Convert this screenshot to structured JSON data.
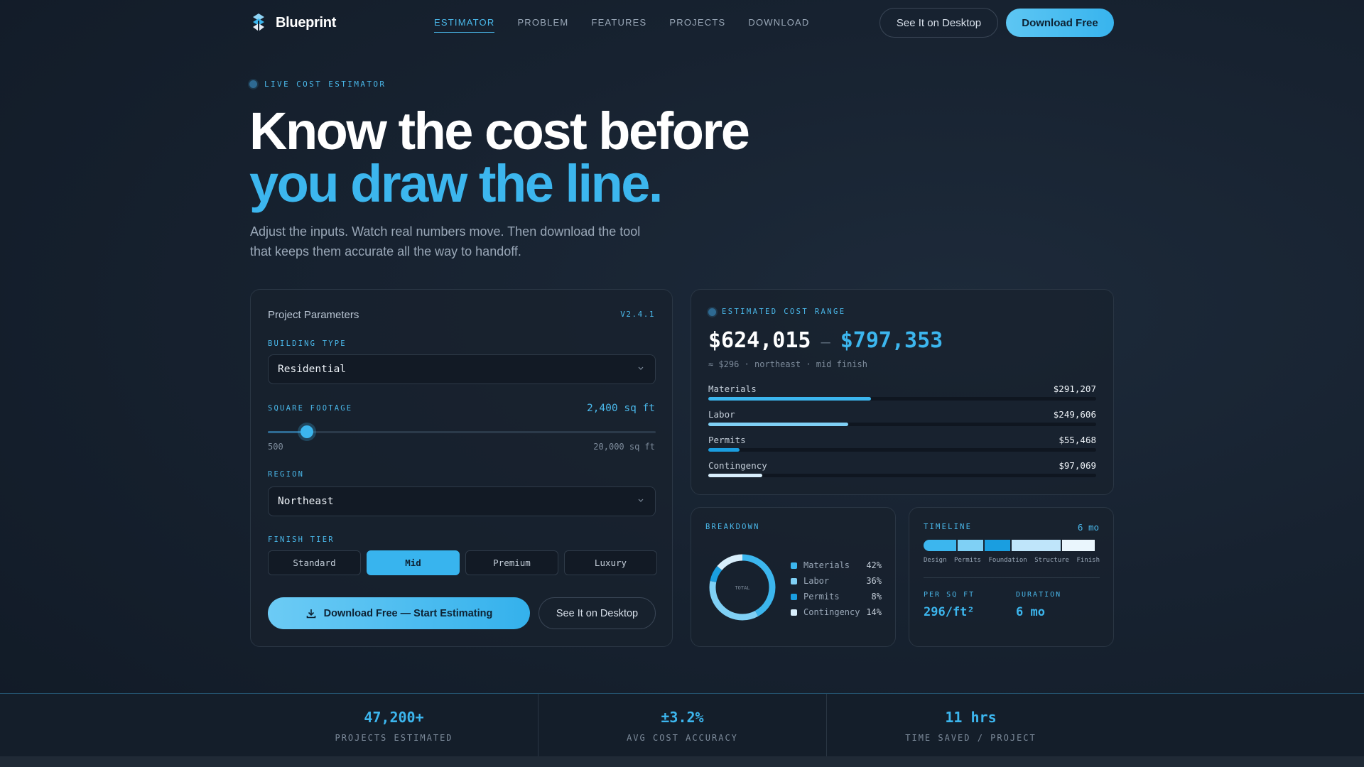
{
  "nav": {
    "brand": "Blueprint",
    "links": [
      "ESTIMATOR",
      "PROBLEM",
      "FEATURES",
      "PROJECTS",
      "DOWNLOAD"
    ],
    "see_desktop": "See It on Desktop",
    "download_free": "Download Free"
  },
  "hero": {
    "eyebrow": "LIVE COST ESTIMATOR",
    "title_line1": "Know the cost before",
    "title_line2": "you draw the line.",
    "subtitle": "Adjust the inputs. Watch real numbers move. Then download the tool that keeps them accurate all the way to handoff."
  },
  "params": {
    "title": "Project Parameters",
    "version": "V2.4.1",
    "building_type_label": "BUILDING TYPE",
    "building_type_value": "Residential",
    "sqft_label": "SQUARE FOOTAGE",
    "sqft_value": "2,400 sq ft",
    "sqft_min": "500",
    "sqft_max": "20,000 sq ft",
    "sqft_slider_fraction": 0.1,
    "region_label": "REGION",
    "region_value": "Northeast",
    "finish_label": "FINISH TIER",
    "tiers": [
      "Standard",
      "Mid",
      "Premium",
      "Luxury"
    ],
    "active_tier": "Mid",
    "cta_primary": "Download Free — Start Estimating",
    "cta_secondary": "See It on Desktop"
  },
  "estimate": {
    "heading": "ESTIMATED COST RANGE",
    "low": "$624,015",
    "dash": "—",
    "high": "$797,353",
    "meta": "≈ $296 · northeast · mid finish",
    "rows": [
      {
        "label": "Materials",
        "value": "$291,207",
        "fraction": 0.42,
        "color": "#3cb6ee"
      },
      {
        "label": "Labor",
        "value": "$249,606",
        "fraction": 0.36,
        "color": "#7fd0f5"
      },
      {
        "label": "Permits",
        "value": "$55,468",
        "fraction": 0.08,
        "color": "#1a9ee0"
      },
      {
        "label": "Contingency",
        "value": "$97,069",
        "fraction": 0.14,
        "color": "#d8eefb"
      }
    ]
  },
  "breakdown": {
    "heading": "BREAKDOWN",
    "center_label": "TOTAL",
    "items": [
      {
        "name": "Materials",
        "pct": "42%",
        "value": 42,
        "color": "#3cb6ee"
      },
      {
        "name": "Labor",
        "pct": "36%",
        "value": 36,
        "color": "#7fd0f5"
      },
      {
        "name": "Permits",
        "pct": "8%",
        "value": 8,
        "color": "#1a9ee0"
      },
      {
        "name": "Contingency",
        "pct": "14%",
        "value": 14,
        "color": "#d8eefb"
      }
    ]
  },
  "timeline": {
    "heading": "TIMELINE",
    "total": "6 mo",
    "phases": [
      {
        "name": "Design",
        "share": 0.19,
        "color": "#3cb6ee"
      },
      {
        "name": "Permits",
        "share": 0.15,
        "color": "#7fd0f5"
      },
      {
        "name": "Foundation",
        "share": 0.15,
        "color": "#1a9ee0"
      },
      {
        "name": "Structure",
        "share": 0.29,
        "color": "#bfe5fa"
      },
      {
        "name": "Finish",
        "share": 0.19,
        "color": "#eaf6fd"
      }
    ],
    "per_sqft_label": "PER SQ FT",
    "per_sqft_value": "296/ft²",
    "duration_label": "DURATION",
    "duration_value": "6 mo"
  },
  "stats": [
    {
      "value": "47,200+",
      "label": "PROJECTS ESTIMATED"
    },
    {
      "value": "±3.2%",
      "label": "AVG COST ACCURACY"
    },
    {
      "value": "11 hrs",
      "label": "TIME SAVED / PROJECT"
    }
  ],
  "colors": {
    "accent": "#3cb6ee",
    "background": "#172230",
    "card": "#18212d"
  }
}
